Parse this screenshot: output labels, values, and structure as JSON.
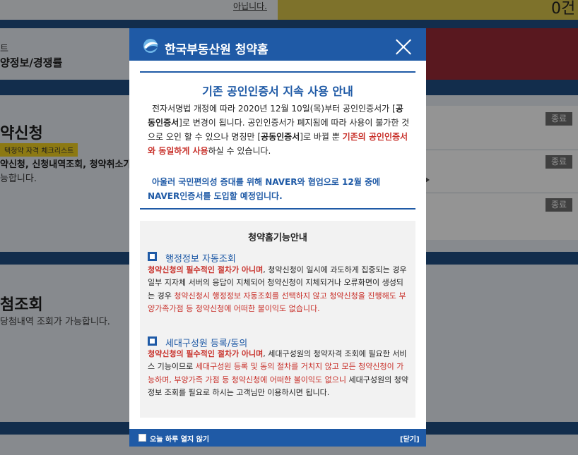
{
  "background": {
    "top_link": "아닙니다.",
    "top_count": "0건",
    "chart_label_short": "트",
    "supply_info": "양정보/경쟁률",
    "apply_heading": "약신청",
    "checklist_tag": "택청약 자격 체크리스트",
    "apply_desc_line1": "약신청, 신청내역조회, 청약취소가",
    "apply_desc_line2": "능합니다.",
    "end_badge": "종료",
    "win_heading": "첨조회",
    "win_desc": "당첨내역 조회가 가능합니다."
  },
  "modal": {
    "brand": "한국부동산원 청약홈",
    "notice_title": "기존 공인인증서 지속 사용 안내",
    "notice": {
      "p1a": "전자서명법 개정에 따라 2020년 12월 10일(목)부터 공인인증서가 [",
      "p1b": "공동인증서",
      "p1c": "]로 변경이 됩니다. 공인인증서가 폐지됨에 따라 사용이 불가한 것으로 오인 할 수 있으나 명칭만 [",
      "p1d": "공동인증서",
      "p1e": "]로 바뀔 뿐 ",
      "p1f": "기존의 공인인증서와 동일하게 사용",
      "p1g": "하실 수 있습니다.",
      "p2": "아울러 국민편의성 증대를 위해 NAVER와 협업으로 12월 중에 NAVER인증서를 도입할 예정입니다."
    },
    "guide_title": "청약홈기능안내",
    "sections": [
      {
        "title": "행정정보 자동조회",
        "b1": "청약신청의 필수적인 절차가 아니며",
        "b2": ", 청약신청이 일시에 과도하게 집중되는 경우 일부 지자체 서버의 응답이 지체되어 청약신청이 지체되거나 오류화면이 생성되는 경우 ",
        "b3": "청약신청시 행정정보 자동조회를 선택하지 않고 청약신청을 진행해도 부양가족가점 등 청약신청에 어떠한 불이익도 없습니다."
      },
      {
        "title": "세대구성원 등록/동의",
        "b1": "청약신청의 필수적인 절차가 아니며",
        "b2": ", 세대구성원의 청약자격 조회에 필요한 서비스 기능이므로 ",
        "b3": "세대구성원 등록 및 동의 절차를 거치지 않고 모든 청약신청이 가능하며, 부양가족 가점 등 청약신청에 어떠한 불이익도 없으니",
        "b4": " 세대구성원의 청약정보 조회를 필요로 하시는 고객님만 이용하시면 됩니다."
      }
    ],
    "footer_checkbox_label": "오늘 하루 열지 않기",
    "footer_close": "[닫기]"
  }
}
